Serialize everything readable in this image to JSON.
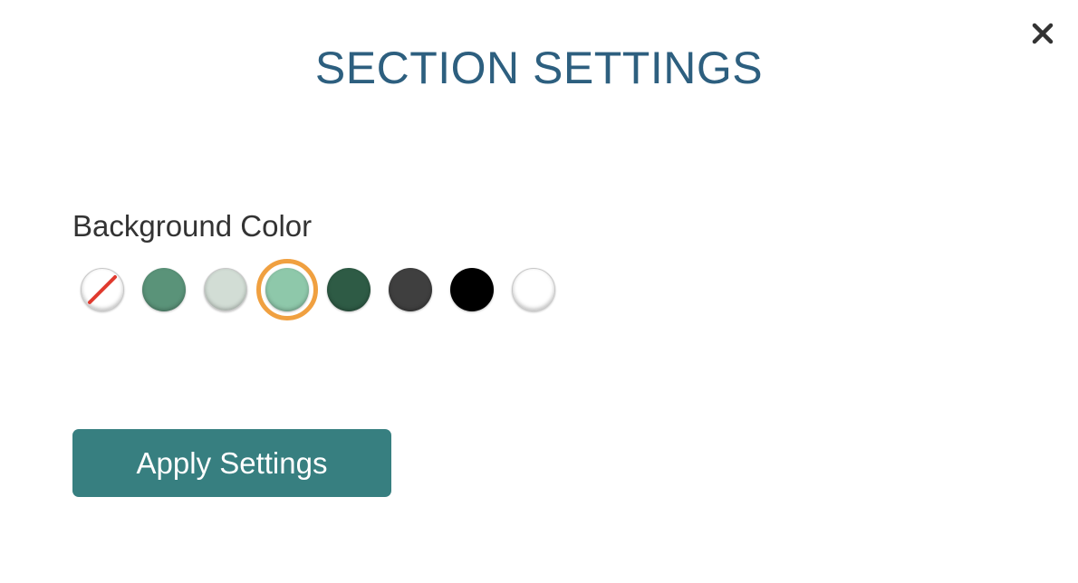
{
  "modal": {
    "title": "SECTION SETTINGS",
    "close_icon": "close-icon",
    "close_color": "#333333"
  },
  "background_color": {
    "label": "Background Color",
    "selected_index": 3,
    "selection_ring_color": "#f0a040",
    "options": [
      {
        "name": "none",
        "color": "#ffffff",
        "icon": "no-color-slash-icon"
      },
      {
        "name": "green",
        "color": "#5a9379"
      },
      {
        "name": "light-gray-green",
        "color": "#d2ddd5"
      },
      {
        "name": "mint",
        "color": "#8ec8aa"
      },
      {
        "name": "dark-green",
        "color": "#2e5b45"
      },
      {
        "name": "dark-gray",
        "color": "#3f3f3f"
      },
      {
        "name": "black",
        "color": "#000000"
      },
      {
        "name": "white",
        "color": "#ffffff"
      }
    ]
  },
  "actions": {
    "apply_label": "Apply Settings",
    "apply_color": "#377f80"
  },
  "theme": {
    "title_color": "#2d5f7f",
    "label_color": "#333333"
  }
}
